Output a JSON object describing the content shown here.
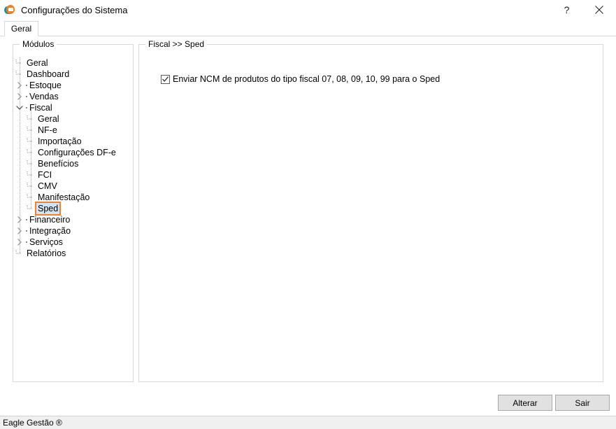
{
  "window": {
    "title": "Configurações do Sistema",
    "icon": "eagle-logo-icon",
    "help_label": "?",
    "close_label": "✕"
  },
  "tabs": [
    {
      "label": "Geral",
      "active": true
    }
  ],
  "modules_panel": {
    "legend": "Módulos",
    "tree": [
      {
        "label": "Geral",
        "depth": 0,
        "toggle": "none"
      },
      {
        "label": "Dashboard",
        "depth": 0,
        "toggle": "none"
      },
      {
        "label": "Estoque",
        "depth": 0,
        "toggle": "collapsed"
      },
      {
        "label": "Vendas",
        "depth": 0,
        "toggle": "collapsed"
      },
      {
        "label": "Fiscal",
        "depth": 0,
        "toggle": "expanded"
      },
      {
        "label": "Geral",
        "depth": 1,
        "toggle": "none"
      },
      {
        "label": "NF-e",
        "depth": 1,
        "toggle": "none"
      },
      {
        "label": "Importação",
        "depth": 1,
        "toggle": "none"
      },
      {
        "label": "Configurações DF-e",
        "depth": 1,
        "toggle": "none"
      },
      {
        "label": "Benefícios",
        "depth": 1,
        "toggle": "none"
      },
      {
        "label": "FCI",
        "depth": 1,
        "toggle": "none"
      },
      {
        "label": "CMV",
        "depth": 1,
        "toggle": "none"
      },
      {
        "label": "Manifestação",
        "depth": 1,
        "toggle": "none"
      },
      {
        "label": "Sped",
        "depth": 1,
        "toggle": "none",
        "selected": true,
        "highlighted": true
      },
      {
        "label": "Financeiro",
        "depth": 0,
        "toggle": "collapsed"
      },
      {
        "label": "Integração",
        "depth": 0,
        "toggle": "collapsed"
      },
      {
        "label": "Serviços",
        "depth": 0,
        "toggle": "collapsed"
      },
      {
        "label": "Relatórios",
        "depth": 0,
        "toggle": "none"
      }
    ]
  },
  "detail_panel": {
    "legend": "Fiscal >> Sped",
    "options": [
      {
        "label": "Enviar NCM de produtos do tipo fiscal 07, 08, 09, 10, 99 para o Sped",
        "checked": true
      }
    ]
  },
  "footer": {
    "primary_button": "Alterar",
    "secondary_button": "Sair"
  },
  "statusbar": {
    "text": "Eagle Gestão ®"
  },
  "colors": {
    "accent_highlight": "#e8833a",
    "selection": "#d5e3f0",
    "logo_orange": "#e8812b",
    "logo_teal": "#2a8c92",
    "button_face": "#e1e1e1",
    "border": "#d8d8d8"
  }
}
